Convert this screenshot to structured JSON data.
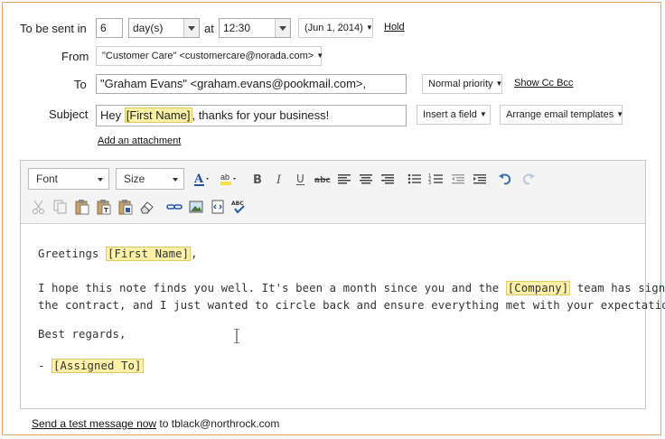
{
  "schedule": {
    "label": "To be sent in",
    "amount": "6",
    "unit": "day(s)",
    "at_label": "at",
    "time": "12:30",
    "date": "(Jun 1, 2014)",
    "hold_label": "Hold"
  },
  "from": {
    "label": "From",
    "value": "\"Customer Care\" <customercare@norada.com>"
  },
  "to": {
    "label": "To",
    "value": "\"Graham Evans\" <graham.evans@pookmail.com>,",
    "priority": "Normal priority",
    "show_cc_bcc": "Show Cc Bcc"
  },
  "subject": {
    "label": "Subject",
    "prefix": "Hey ",
    "field": "[First Name]",
    "suffix": ", thanks for your business!",
    "insert_field": "Insert a field",
    "templates": "Arrange email templates"
  },
  "attachment": {
    "label": "Add an attachment"
  },
  "toolbar": {
    "font": "Font",
    "size": "Size",
    "icons": [
      "font-color-icon",
      "highlight-color-icon",
      "bold-icon",
      "italic-icon",
      "underline-icon",
      "strikethrough-icon",
      "align-left-icon",
      "align-center-icon",
      "align-right-icon",
      "bullet-list-icon",
      "numbered-list-icon",
      "outdent-icon",
      "indent-icon",
      "undo-icon",
      "redo-icon",
      "cut-icon",
      "copy-icon",
      "paste-icon",
      "paste-text-icon",
      "paste-word-icon",
      "eraser-icon",
      "link-icon",
      "image-icon",
      "embed-icon",
      "spellcheck-icon"
    ]
  },
  "body": {
    "greeting_prefix": "Greetings ",
    "greeting_field": "[First Name]",
    "greeting_suffix": ",",
    "line1_prefix": "I hope this note finds you well. It's been a month since you and the ",
    "line1_field": "[Company]",
    "line1_suffix": " team has signed",
    "line2": "the contract, and I just wanted to circle back and ensure everything met with your expectations.",
    "closing": "Best regards,",
    "sign_prefix": "- ",
    "sign_field": "[Assigned To]"
  },
  "footer": {
    "test_link": "Send a test message now",
    "test_suffix": " to tblack@northrock.com"
  },
  "colors": {
    "frame": "#e8a66a",
    "highlight": "#fff2a8"
  }
}
